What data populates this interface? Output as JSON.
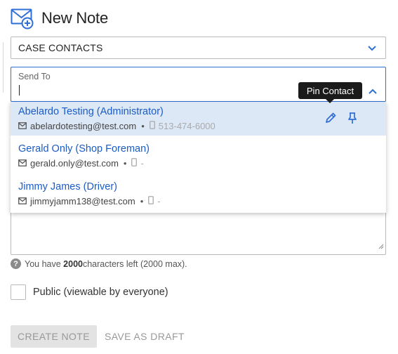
{
  "header": {
    "title": "New Note",
    "icon": "mail-plus-icon"
  },
  "category_select": {
    "value": "CASE CONTACTS"
  },
  "send_to": {
    "label": "Send To",
    "value": ""
  },
  "tooltip": {
    "text": "Pin Contact"
  },
  "contacts": [
    {
      "name": "Abelardo Testing",
      "role": "(Administrator)",
      "email": "abelardotesting@test.com",
      "phone": "513-474-6000"
    },
    {
      "name": "Gerald Only",
      "role": "(Shop Foreman)",
      "email": "gerald.only@test.com",
      "phone": "-"
    },
    {
      "name": "Jimmy James",
      "role": "(Driver)",
      "email": "jimmyjamm138@test.com",
      "phone": "-"
    }
  ],
  "char_count": {
    "prefix": "You have ",
    "count": "2000",
    "suffix": " characters left (2000 max)."
  },
  "public_checkbox": {
    "label": "Public (viewable by everyone)",
    "checked": false
  },
  "buttons": {
    "create": "CREATE NOTE",
    "draft": "SAVE AS DRAFT"
  },
  "colors": {
    "accent": "#2f6fd6",
    "link": "#1a5cc7",
    "highlight": "#dde8f7"
  }
}
